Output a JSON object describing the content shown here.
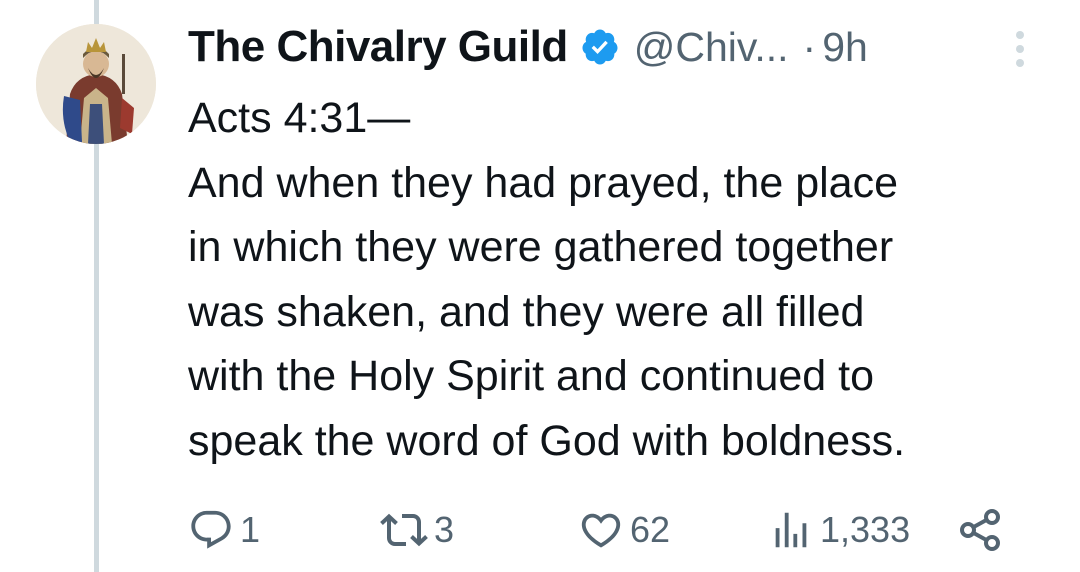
{
  "tweet": {
    "display_name": "The Chivalry Guild",
    "handle": "@Chiv...",
    "separator": "·",
    "time": "9h",
    "verified_badge": "verified-badge-icon",
    "text_lines": [
      "Acts 4:31—",
      "And when they had prayed, the place",
      "in which they were gathered together",
      "was shaken, and they were all filled",
      "with the Holy Spirit and continued to",
      "speak the word of God with boldness."
    ]
  },
  "actions": {
    "reply": {
      "icon": "reply-icon",
      "count": "1"
    },
    "repost": {
      "icon": "repost-icon",
      "count": "3"
    },
    "like": {
      "icon": "heart-icon",
      "count": "62"
    },
    "views": {
      "icon": "views-icon",
      "count": "1,333"
    },
    "share": {
      "icon": "share-icon"
    }
  },
  "colors": {
    "text_primary": "#0f1419",
    "text_secondary": "#536471",
    "verified_blue": "#1d9bf0",
    "thread_line": "#cfd9de"
  }
}
